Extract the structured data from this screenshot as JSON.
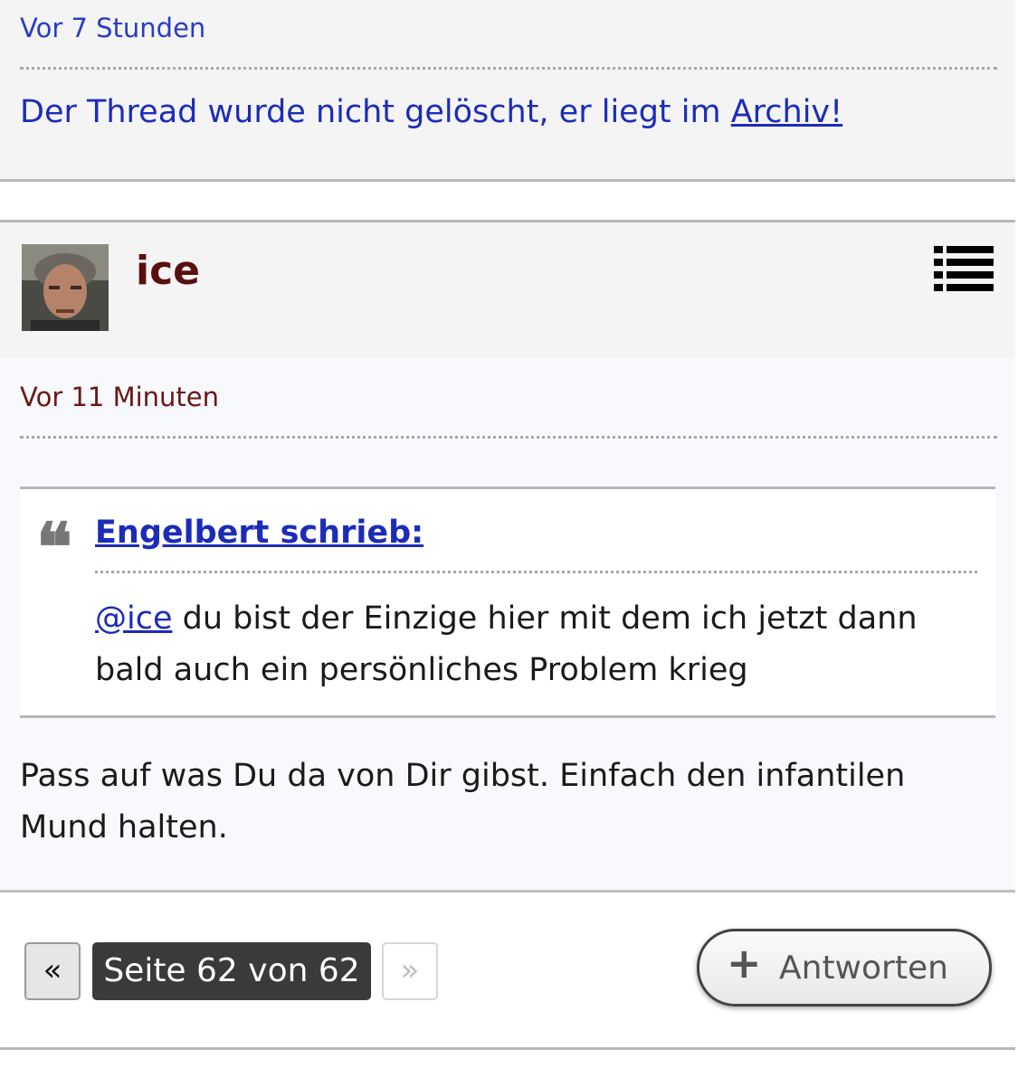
{
  "previous_post": {
    "time": "Vor 7 Stunden",
    "text": "Der Thread wurde nicht gelöscht, er liegt im ",
    "link_text": "Archiv!"
  },
  "post": {
    "username": "ice",
    "time": "Vor 11 Minuten",
    "menu_icon": "list-icon",
    "quote": {
      "icon": "quote-icon",
      "mark": "❝",
      "author": "Engelbert schrieb:",
      "mention": "@ice",
      "text": " du bist der Einzige hier mit dem ich jetzt dann bald auch ein persönliches Problem krieg"
    },
    "body": "Pass auf was Du da von Dir gibst. Einfach den infantilen Mund halten."
  },
  "pagination": {
    "prev": "«",
    "current": "Seite 62 von 62",
    "next": "»"
  },
  "reply_button": {
    "icon": "plus-icon",
    "plus": "+",
    "label": "Antworten"
  },
  "colors": {
    "link": "#1c2cb8",
    "username": "#5a0f0f",
    "pager_active": "#3a3a3a"
  }
}
